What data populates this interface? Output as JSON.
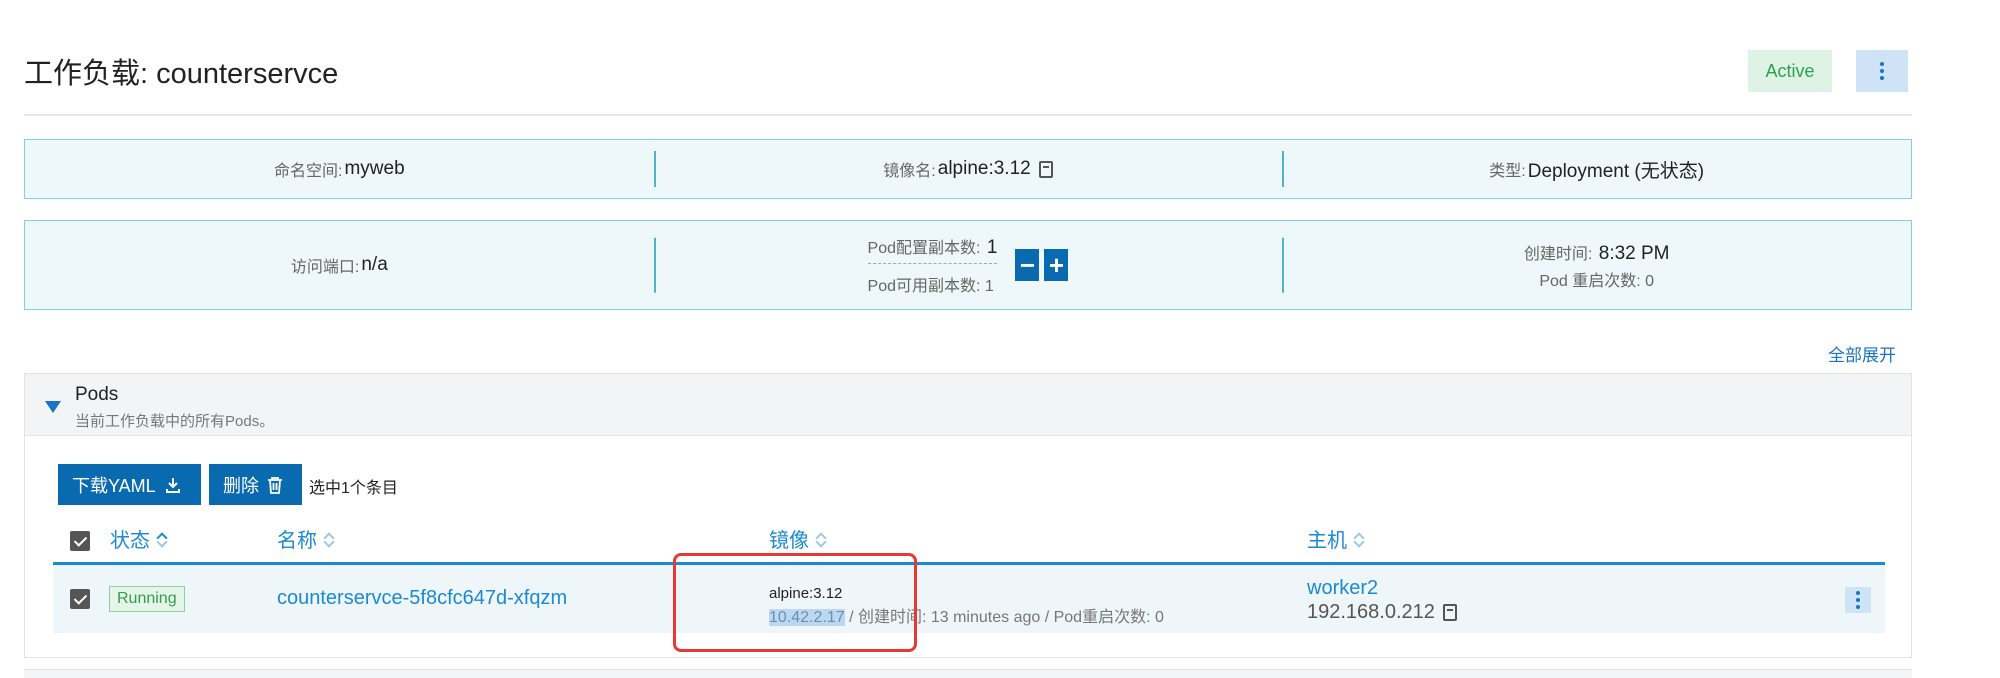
{
  "header": {
    "title": "工作负载: counterservce",
    "status": "Active"
  },
  "info_row1": {
    "namespace_label": "命名空间:",
    "namespace_value": "myweb",
    "image_label": "镜像名:",
    "image_value": "alpine:3.12",
    "type_label": "类型:",
    "type_value": "Deployment (无状态)"
  },
  "info_row2": {
    "port_label": "访问端口:",
    "port_value": "n/a",
    "replica_config_label": "Pod配置副本数:",
    "replica_config_value": "1",
    "replica_available_label": "Pod可用副本数:",
    "replica_available_value": "1",
    "decrement_label": "−",
    "increment_label": "+",
    "created_label": "创建时间:",
    "created_value": "8:32 PM",
    "restarts_label": "Pod 重启次数:",
    "restarts_value": "0"
  },
  "expand_all": "全部展开",
  "pods": {
    "title": "Pods",
    "description": "当前工作负载中的所有Pods。",
    "download_yaml": "下载YAML",
    "delete": "删除",
    "selected_text": "选中1个条目",
    "columns": {
      "status": "状态",
      "name": "名称",
      "image": "镜像",
      "host": "主机"
    },
    "rows": [
      {
        "status": "Running",
        "name": "counterservce-5f8cfc647d-xfqzm",
        "image": "alpine:3.12",
        "ip": "10.42.2.17",
        "meta_rest": " / 创建时间: 13 minutes ago / Pod重启次数: 0",
        "host": "worker2",
        "host_ip": "192.168.0.212"
      }
    ]
  },
  "colors": {
    "accent": "#1a8ad4",
    "primary_button": "#0a6aaf",
    "success": "#2fa04b",
    "info_border": "#7fd3dd",
    "highlight": "#e53935"
  },
  "icons": [
    "more-vertical-icon",
    "copy-icon",
    "minus-icon",
    "plus-icon",
    "caret-down-icon",
    "download-icon",
    "trash-icon",
    "sort-icon",
    "checkbox-checked-icon"
  ]
}
